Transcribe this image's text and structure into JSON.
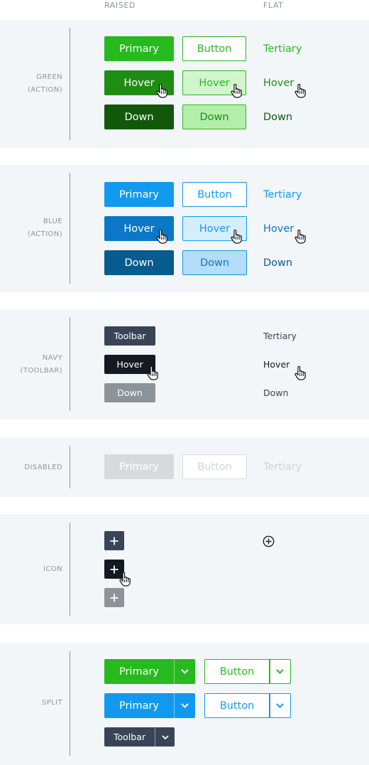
{
  "header": {
    "raised": "RAISED",
    "flat": "FLAT"
  },
  "green": {
    "label_line1": "GREEN",
    "label_line2": "(ACTION)",
    "primary": "Primary",
    "button": "Button",
    "tertiary": "Tertiary",
    "hover": "Hover",
    "down": "Down",
    "colors": {
      "primary": "#27ba1e",
      "hover": "#1f8c14",
      "down": "#11580b"
    }
  },
  "blue": {
    "label_line1": "BLUE",
    "label_line2": "(ACTION)",
    "primary": "Primary",
    "button": "Button",
    "tertiary": "Tertiary",
    "hover": "Hover",
    "down": "Down",
    "colors": {
      "primary": "#1199f0",
      "hover": "#0b78c7",
      "down": "#065b8f"
    }
  },
  "navy": {
    "label_line1": "NAVY",
    "label_line2": "(TOOLBAR)",
    "toolbar": "Toolbar",
    "tertiary": "Tertiary",
    "hover": "Hover",
    "down": "Down",
    "colors": {
      "toolbar": "#394556",
      "hover": "#141a22",
      "down": "#8c9399"
    }
  },
  "disabled": {
    "label": "DISABLED",
    "primary": "Primary",
    "button": "Button",
    "tertiary": "Tertiary"
  },
  "icon": {
    "label": "ICON",
    "raised_icon": "plus-icon",
    "flat_icon": "circle-plus-icon"
  },
  "split": {
    "label": "SPLIT",
    "green_primary": "Primary",
    "green_button": "Button",
    "blue_primary": "Primary",
    "blue_button": "Button",
    "toolbar": "Toolbar",
    "caret_icon": "chevron-down-icon"
  }
}
